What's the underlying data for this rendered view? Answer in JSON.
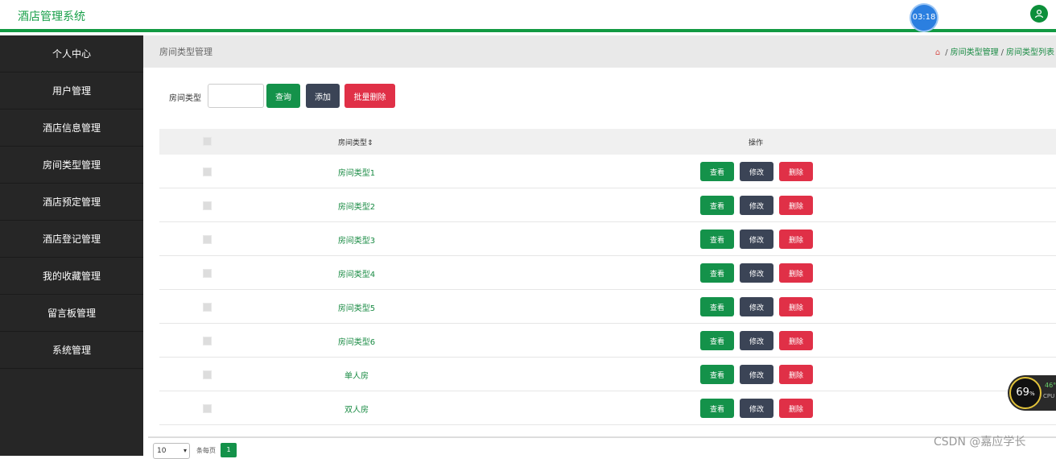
{
  "header": {
    "app_title": "酒店管理系统",
    "timer": "03:18"
  },
  "sidebar": {
    "items": [
      {
        "label": "个人中心"
      },
      {
        "label": "用户管理"
      },
      {
        "label": "酒店信息管理"
      },
      {
        "label": "房间类型管理"
      },
      {
        "label": "酒店预定管理"
      },
      {
        "label": "酒店登记管理"
      },
      {
        "label": "我的收藏管理"
      },
      {
        "label": "留言板管理"
      },
      {
        "label": "系统管理"
      }
    ]
  },
  "breadcrumb": {
    "page_title": "房间类型管理",
    "items": [
      "房间类型管理",
      "房间类型列表"
    ],
    "separator": "/"
  },
  "search": {
    "label": "房间类型",
    "placeholder": "",
    "query_button": "查询",
    "add_button": "添加",
    "batch_delete_button": "批量删除"
  },
  "table": {
    "headers": {
      "type": "房间类型",
      "actions": "操作"
    },
    "sort_icon": "⇕",
    "rows": [
      {
        "type": "房间类型1"
      },
      {
        "type": "房间类型2"
      },
      {
        "type": "房间类型3"
      },
      {
        "type": "房间类型4"
      },
      {
        "type": "房间类型5"
      },
      {
        "type": "房间类型6"
      },
      {
        "type": "单人房"
      },
      {
        "type": "双人房"
      }
    ],
    "row_actions": {
      "view": "查看",
      "edit": "修改",
      "delete": "删除"
    }
  },
  "pagination": {
    "page_size": "10",
    "per_page_label": "条每页",
    "current_page": "1"
  },
  "overlay": {
    "cpu_percent": "69",
    "cpu_percent_unit": "%",
    "cpu_secondary": "46°",
    "cpu_label": "CPU",
    "watermark": "CSDN @嘉应学长"
  },
  "colors": {
    "accent": "#129a43",
    "danger": "#e03047",
    "dark_button": "#3b4456",
    "sidebar_bg": "#262626"
  }
}
